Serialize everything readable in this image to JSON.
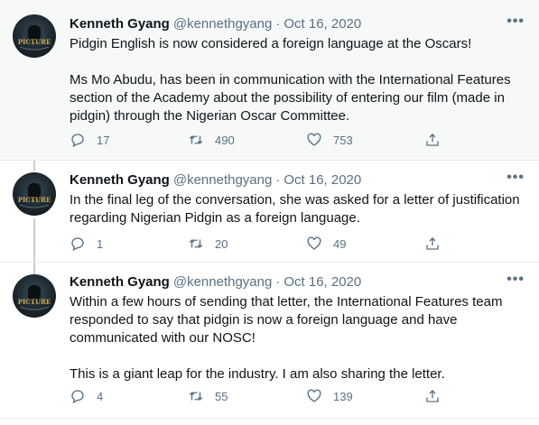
{
  "tweets": [
    {
      "name": "Kenneth Gyang",
      "handle": "@kennethgyang",
      "separator": "·",
      "date": "Oct 16, 2020",
      "more": "•••",
      "paragraphs": [
        "Pidgin English is now considered a foreign language at the Oscars!",
        "Ms Mo Abudu, has been in communication with the International Features section of the Academy about the possibility of entering our film (made in pidgin) through the Nigerian Oscar Committee."
      ],
      "replies": "17",
      "retweets": "490",
      "likes": "753"
    },
    {
      "name": "Kenneth Gyang",
      "handle": "@kennethgyang",
      "separator": "·",
      "date": "Oct 16, 2020",
      "more": "•••",
      "paragraphs": [
        "In the final leg of the conversation, she was asked for a letter of justification regarding Nigerian Pidgin as a foreign language."
      ],
      "replies": "1",
      "retweets": "20",
      "likes": "49"
    },
    {
      "name": "Kenneth Gyang",
      "handle": "@kennethgyang",
      "separator": "·",
      "date": "Oct 16, 2020",
      "more": "•••",
      "paragraphs": [
        "Within a few hours of sending that letter, the International Features team responded to say that pidgin is now a foreign language and have communicated with our NOSC!",
        "This is a giant leap for the industry. I am also sharing the letter."
      ],
      "replies": "4",
      "retweets": "55",
      "likes": "139"
    }
  ],
  "avatar_text": "PICTURE",
  "colors": {
    "text": "#0f1419",
    "secondary": "#5b7083",
    "highlight_bg": "#f7f9f9",
    "thread_line": "#c4cfd6",
    "avatar_text": "#c8a85a"
  },
  "icons": [
    "reply-icon",
    "retweet-icon",
    "like-icon",
    "share-icon",
    "more-icon"
  ]
}
